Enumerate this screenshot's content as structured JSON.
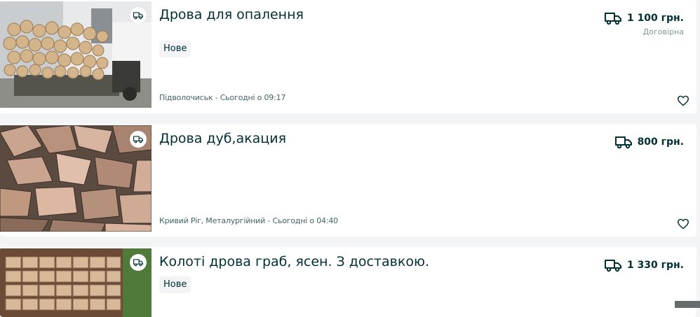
{
  "listings": [
    {
      "title": "Дрова для опалення",
      "price": "1 100 грн.",
      "negotiable": "Договірна",
      "badge": "Нове",
      "location_date": "Підволочиськ - Сьогодні о 09:17",
      "delivery_icon": "truck-icon",
      "favorite_icon": "heart-icon"
    },
    {
      "title": "Дрова дуб,акация",
      "price": "800 грн.",
      "location_date": "Кривий Ріг, Металургійний - Сьогодні о 04:40",
      "delivery_icon": "truck-icon",
      "favorite_icon": "heart-icon"
    },
    {
      "title": "Колоті дрова граб, ясен. З доставкою.",
      "price": "1 330 грн.",
      "badge": "Нове",
      "delivery_icon": "truck-icon",
      "favorite_icon": "heart-icon"
    }
  ],
  "colors": {
    "text_primary": "#002f34",
    "text_secondary": "#406367",
    "background": "#f2f4f5",
    "card": "#ffffff"
  }
}
